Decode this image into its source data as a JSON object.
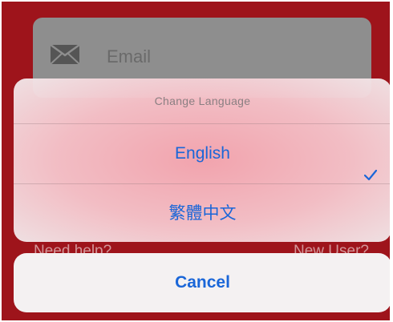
{
  "background": {
    "email_placeholder": "Email",
    "email_icon": "envelope-icon",
    "need_help_link": "Need help?",
    "new_user_link": "New User?"
  },
  "action_sheet": {
    "title": "Change Language",
    "options": [
      {
        "label": "English",
        "selected": true
      },
      {
        "label": "繁體中文",
        "selected": false
      }
    ],
    "check_icon": "checkmark-icon",
    "cancel_label": "Cancel"
  },
  "colors": {
    "background_red": "#9e141b",
    "accent_blue": "#1a66d8"
  }
}
